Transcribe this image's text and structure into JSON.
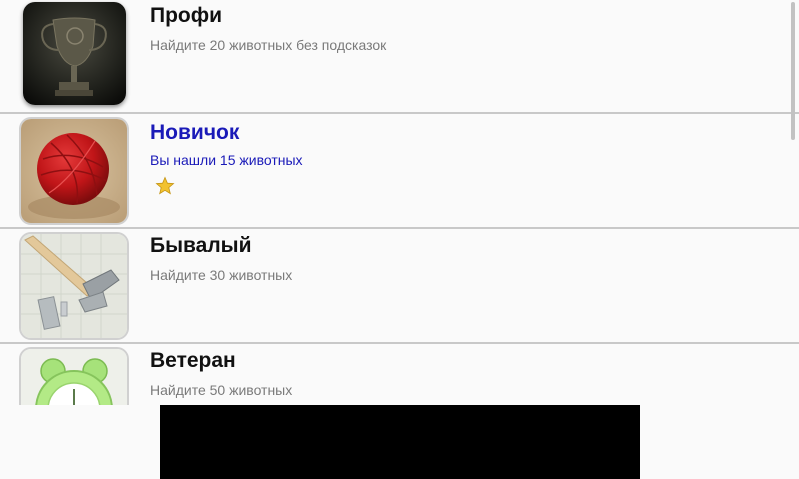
{
  "achievements": [
    {
      "title": "Профи",
      "subtitle": "Найдите 20 животных без подсказок",
      "icon": "trophy-icon",
      "active": false
    },
    {
      "title": "Новичок",
      "subtitle": "Вы нашли 15 животных",
      "icon": "yarn-ball-icon",
      "active": true,
      "stars": 1
    },
    {
      "title": "Бывалый",
      "subtitle": "Найдите 30 животных",
      "icon": "hammer-icon",
      "active": false
    },
    {
      "title": "Ветеран",
      "subtitle": "Найдите 50 животных",
      "icon": "alarm-clock-icon",
      "active": false
    }
  ],
  "colors": {
    "active_text": "#1a1ab8",
    "title_text": "#111111",
    "subtitle_text": "#7a7a7a",
    "divider": "#c8c8c8",
    "star": "#f2c230"
  }
}
